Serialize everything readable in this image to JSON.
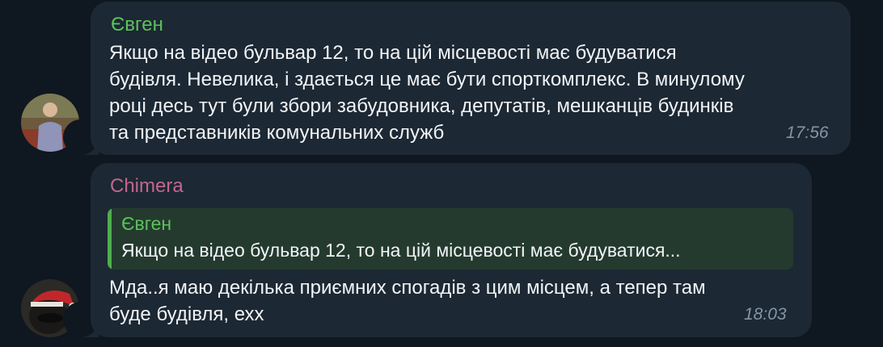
{
  "messages": [
    {
      "sender": "Євген",
      "sender_color": "#5cc25a",
      "text": "Якщо на відео бульвар 12, то на цій місцевості має будуватися\nбудівля. Невелика, і здається це має бути спорткомплекс. В минулому\nроці десь тут були збори забудовника, депутатів, мешканців будинків\nта представників комунальних служб",
      "time": "17:56"
    },
    {
      "sender": "Chimera",
      "sender_color": "#c2668f",
      "reply": {
        "sender": "Євген",
        "text": "Якщо на відео бульвар 12, то на цій місцевості має будуватися..."
      },
      "text": "Мда..я маю декілька приємних спогадів з цим місцем, а тепер там\nбуде будівля, ехх",
      "time": "18:03"
    }
  ]
}
